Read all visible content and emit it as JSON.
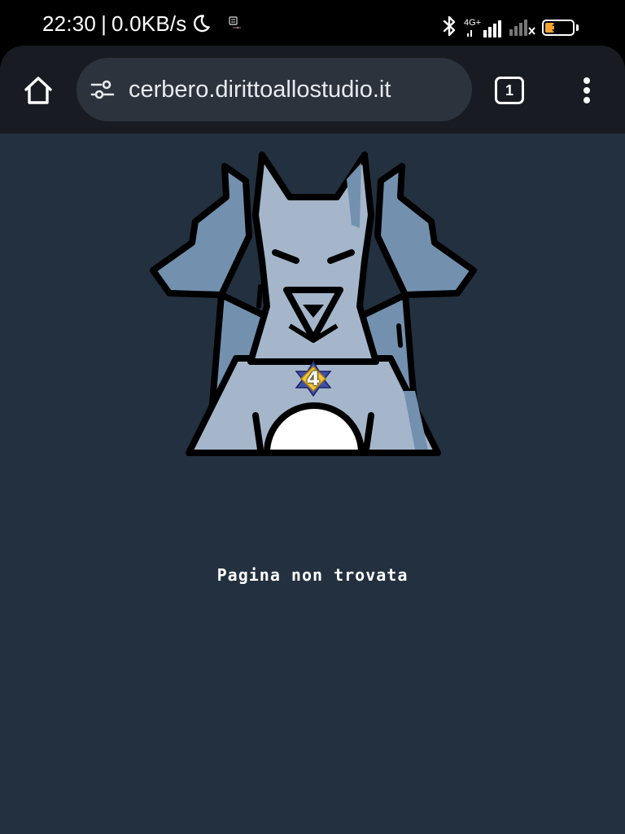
{
  "status_bar": {
    "time": "22:30",
    "separator": "|",
    "net_speed": "0.0KB/s",
    "network_type": "4G+",
    "battery_level": "33",
    "battery_fraction": 0.33,
    "battery_color": "#f2a532",
    "icons": [
      "moon-icon",
      "notification-icon",
      "bluetooth-icon",
      "signal-icon",
      "signal-off-icon",
      "battery-icon"
    ]
  },
  "browser": {
    "url": "cerbero.dirittoallostudio.it",
    "tab_count": "1",
    "icons": [
      "home-icon",
      "tune-icon",
      "tabs-icon",
      "more-vert-icon"
    ]
  },
  "page": {
    "message": "Pagina non trovata",
    "background_color": "#23303f",
    "illustration": "cerberus-icon",
    "badge_number": "4",
    "colors": {
      "dog_light": "#a5b6cb",
      "dog_dark": "#7391af",
      "outline": "#000000",
      "badge_gold": "#f2c43a"
    }
  }
}
